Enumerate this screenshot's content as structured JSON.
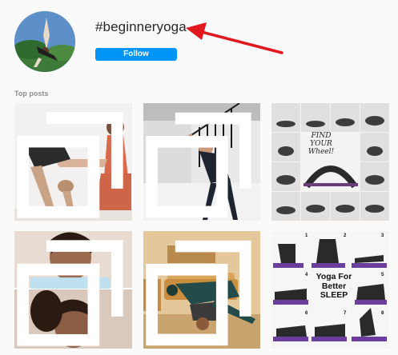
{
  "header": {
    "hashtag": "#beginneryoga",
    "follow_label": "Follow"
  },
  "section": {
    "label": "Top posts"
  },
  "posts": [
    {
      "id": "post-1",
      "multiple": true
    },
    {
      "id": "post-2",
      "multiple": true
    },
    {
      "id": "post-3",
      "multiple": false,
      "title": "FIND YOUR Wheel!"
    },
    {
      "id": "post-4",
      "multiple": true
    },
    {
      "id": "post-5",
      "multiple": true
    },
    {
      "id": "post-6",
      "multiple": false,
      "title_lines": [
        "Yoga For",
        "Better",
        "SLEEP"
      ],
      "numbers": [
        "1",
        "2",
        "3",
        "4",
        "5",
        "6",
        "7",
        "8"
      ]
    }
  ],
  "colors": {
    "follow_bg": "#0095f6",
    "arrow": "#e0191e",
    "page_bg": "#fafafa"
  }
}
